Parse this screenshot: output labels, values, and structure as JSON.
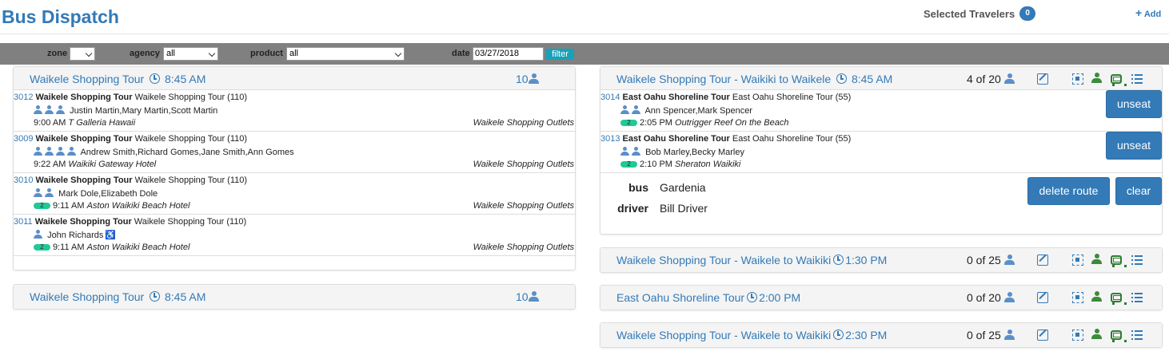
{
  "header": {
    "title": "Bus Dispatch",
    "selected_travelers_label": "Selected Travelers",
    "selected_travelers_count": "0",
    "add_label": "Add"
  },
  "filters": {
    "zone_label": "zone",
    "zone_value": "",
    "agency_label": "agency",
    "agency_value": "all",
    "product_label": "product",
    "product_value": "all",
    "date_label": "date",
    "date_value": "03/27/2018",
    "filter_button": "filter"
  },
  "left_panels": [
    {
      "title": "Waikele Shopping Tour",
      "time": "8:45 AM",
      "count": "10",
      "bookings": [
        {
          "id": "3012",
          "product": "Waikele Shopping Tour",
          "product_detail": "Waikele Shopping Tour (110)",
          "names": "Justin Martin,Mary Martin,Scott Martin",
          "pax": 3,
          "badge": "",
          "pickup_time": "9:00 AM",
          "pickup_location": "T Galleria Hawaii",
          "destination": "Waikele Shopping Outlets"
        },
        {
          "id": "3009",
          "product": "Waikele Shopping Tour",
          "product_detail": "Waikele Shopping Tour (110)",
          "names": "Andrew Smith,Richard Gomes,Jane Smith,Ann Gomes",
          "pax": 4,
          "badge": "",
          "pickup_time": "9:22 AM",
          "pickup_location": "Waikiki Gateway Hotel",
          "destination": "Waikele Shopping Outlets"
        },
        {
          "id": "3010",
          "product": "Waikele Shopping Tour",
          "product_detail": "Waikele Shopping Tour (110)",
          "names": "Mark Dole,Elizabeth Dole",
          "pax": 2,
          "badge": "2",
          "pickup_time": "9:11 AM",
          "pickup_location": "Aston Waikiki Beach Hotel",
          "destination": "Waikele Shopping Outlets"
        },
        {
          "id": "3011",
          "product": "Waikele Shopping Tour",
          "product_detail": "Waikele Shopping Tour (110)",
          "names": "John Richards",
          "pax": 1,
          "wheelchair": true,
          "badge": "2",
          "pickup_time": "9:11 AM",
          "pickup_location": "Aston Waikiki Beach Hotel",
          "destination": "Waikele Shopping Outlets"
        }
      ]
    },
    {
      "title": "Waikele Shopping Tour",
      "time": "8:45 AM",
      "count": "10"
    }
  ],
  "right_panels": [
    {
      "title": "Waikele Shopping Tour - Waikiki to Waikele",
      "time": "8:45 AM",
      "capacity": "4 of 20",
      "bookings": [
        {
          "id": "3014",
          "product": "East Oahu Shoreline Tour",
          "product_detail": "East Oahu Shoreline Tour (55)",
          "names": "Ann Spencer,Mark Spencer",
          "pax": 2,
          "badge": "2",
          "pickup_time": "2:05 PM",
          "pickup_location": "Outrigger Reef On the Beach",
          "button": "unseat"
        },
        {
          "id": "3013",
          "product": "East Oahu Shoreline Tour",
          "product_detail": "East Oahu Shoreline Tour (55)",
          "names": "Bob Marley,Becky Marley",
          "pax": 2,
          "badge": "2",
          "pickup_time": "2:10 PM",
          "pickup_location": "Sheraton Waikiki",
          "button": "unseat"
        }
      ],
      "bus_label": "bus",
      "bus_value": "Gardenia",
      "driver_label": "driver",
      "driver_value": "Bill Driver",
      "delete_route_button": "delete route",
      "clear_button": "clear"
    },
    {
      "title": "Waikele Shopping Tour - Waikele to Waikiki",
      "time": "1:30 PM",
      "capacity": "0 of 25"
    },
    {
      "title": "East Oahu Shoreline Tour",
      "time": "2:00 PM",
      "capacity": "0 of 20"
    },
    {
      "title": "Waikele Shopping Tour - Waikele to Waikiki",
      "time": "2:30 PM",
      "capacity": "0 of 25"
    }
  ],
  "icons": {
    "add": "plus-icon",
    "time": "clock-icon",
    "traveler": "person-icon",
    "edit": "edit-icon",
    "seat": "seat-select-icon",
    "driver": "driver-icon",
    "bus": "bus-icon",
    "list": "list-icon",
    "wheelchair": "wheelchair-icon"
  },
  "colors": {
    "primary": "#337ab7",
    "filter_bar": "#808080",
    "filter_button": "#17a2b8",
    "badge": "#20c997",
    "driver_icon": "#3c8a3c"
  }
}
